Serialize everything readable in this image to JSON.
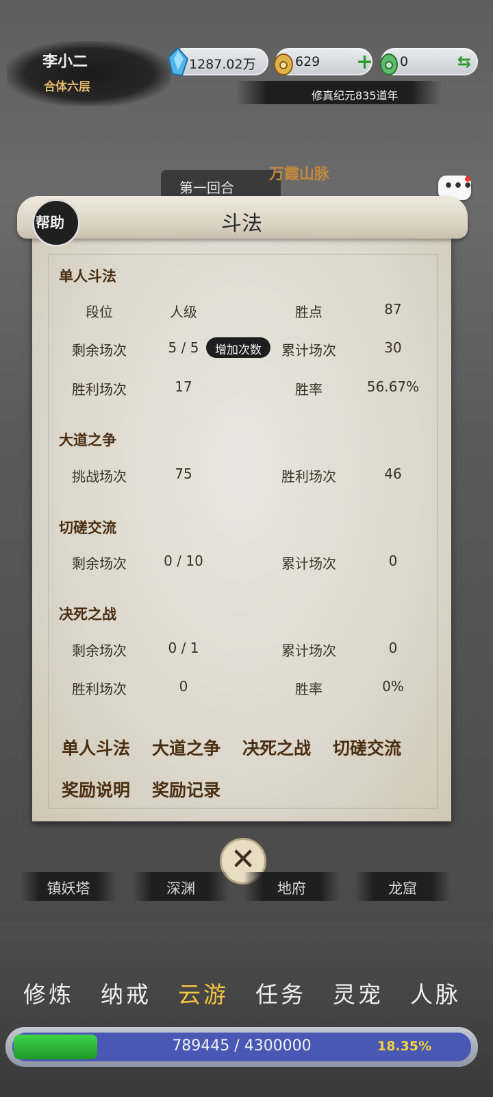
{
  "header": {
    "player_name": "李小二",
    "realm": "合体六层",
    "spirit_stones": "1287.02万",
    "gold": "629",
    "jade": "0",
    "era": "修真纪元835道年"
  },
  "background": {
    "round_label": "第一回合",
    "location_label": "万霞山脉"
  },
  "panel": {
    "help_label": "帮助",
    "title": "斗法",
    "sections": {
      "solo": {
        "title": "单人斗法",
        "rank_label": "段位",
        "rank_value": "人级",
        "points_label": "胜点",
        "points_value": "87",
        "remaining_label": "剩余场次",
        "remaining_value": "5 / 5",
        "add_button": "增加次数",
        "total_label": "累计场次",
        "total_value": "30",
        "wins_label": "胜利场次",
        "wins_value": "17",
        "winrate_label": "胜率",
        "winrate_value": "56.67%"
      },
      "dao": {
        "title": "大道之争",
        "challenge_label": "挑战场次",
        "challenge_value": "75",
        "wins_label": "胜利场次",
        "wins_value": "46"
      },
      "spar": {
        "title": "切磋交流",
        "remaining_label": "剩余场次",
        "remaining_value": "0 / 10",
        "total_label": "累计场次",
        "total_value": "0"
      },
      "death": {
        "title": "决死之战",
        "remaining_label": "剩余场次",
        "remaining_value": "0 / 1",
        "total_label": "累计场次",
        "total_value": "0",
        "wins_label": "胜利场次",
        "wins_value": "0",
        "winrate_label": "胜率",
        "winrate_value": "0%"
      }
    },
    "links": [
      "单人斗法",
      "大道之争",
      "决死之战",
      "切磋交流",
      "奖励说明",
      "奖励记录"
    ]
  },
  "close_icon": "close-icon",
  "map_tabs": [
    "镇妖塔",
    "深渊",
    "地府",
    "龙窟"
  ],
  "nav": {
    "items": [
      "修炼",
      "纳戒",
      "云游",
      "任务",
      "灵宠",
      "人脉"
    ],
    "active": "云游"
  },
  "exp": {
    "text": "789445 / 4300000",
    "percent": "18.35%",
    "fraction": 0.1835
  },
  "colors": {
    "accent_gold": "#f3c241",
    "section_brown": "#4a2e12",
    "exp_green": "#2fb83a",
    "exp_track": "#4a58b5"
  }
}
